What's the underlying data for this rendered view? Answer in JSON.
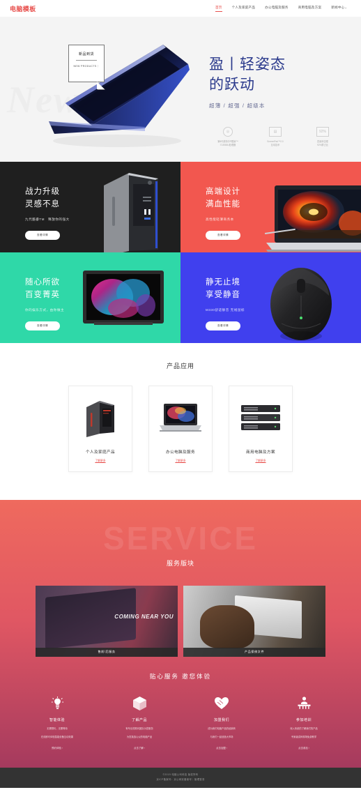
{
  "header": {
    "logo": "电脑模板",
    "nav": [
      {
        "label": "首页",
        "active": true
      },
      {
        "label": "个人及家庭产品",
        "active": false
      },
      {
        "label": "办公电脑及服务",
        "active": false
      },
      {
        "label": "商用电脑及方案",
        "active": false
      },
      {
        "label": "新闻中心",
        "active": false,
        "caret": "⌄"
      }
    ]
  },
  "hero": {
    "badge_title": "新品到货",
    "badge_sub": "NEW PRODUCTS｜",
    "heading_line1": "盈丨轻姿态",
    "heading_line2": "的跃动",
    "subtitle": "超薄 / 超强 / 超级本",
    "watermark": "New",
    "features": [
      {
        "icon": "cpu-icon",
        "glyph": "◎",
        "line1": "第8代英特尔®酷睿™",
        "line2": "i7-8565U处理器"
      },
      {
        "icon": "screen-icon",
        "glyph": "▤",
        "line1": "ScreenPad™2.0",
        "line2": "互动技术"
      },
      {
        "icon": "display-icon",
        "glyph": "92%",
        "line1": "四面窄边框",
        "line2": "92%屏占比"
      }
    ]
  },
  "panels": [
    {
      "theme": "dark",
      "heading_line1": "战力升级",
      "heading_line2": "灵感不息",
      "subtitle": "九代酷睿TM　释放你的强大",
      "button": "查看详情",
      "image": "desktop-tower-image"
    },
    {
      "theme": "red",
      "heading_line1": "高端设计",
      "heading_line2": "满血性能",
      "subtitle": "高性能轻薄商务本",
      "button": "查看详情",
      "image": "laptop-image"
    },
    {
      "theme": "teal",
      "heading_line1": "随心所欲",
      "heading_line2": "百变菁英",
      "subtitle": "你的娱乐方式，由你做主",
      "button": "查看详情",
      "image": "tablet-image"
    },
    {
      "theme": "blue",
      "heading_line1": "静无止境",
      "heading_line2": "享受静音",
      "subtitle": "M330舒适静音 无线鼠标",
      "button": "查看详情",
      "image": "wireless-mouse-image"
    }
  ],
  "applications": {
    "title": "产品应用",
    "cards": [
      {
        "name": "个人及家庭产品",
        "more": "了解更多",
        "image": "desktop-pc-image"
      },
      {
        "name": "办公电脑及服务",
        "more": "了解更多",
        "image": "office-laptop-image"
      },
      {
        "name": "商用电脑及方案",
        "more": "了解更多",
        "image": "server-rack-image"
      }
    ]
  },
  "service": {
    "watermark": "SERVICE",
    "title": "服务版块",
    "cards": [
      {
        "caption": "售前/后服务",
        "overlay": "COMING NEAR YOU",
        "image": "presentation-screens-image"
      },
      {
        "caption": "产品保修文件",
        "overlay": "",
        "image": "hand-on-laptop-image"
      }
    ]
  },
  "care": {
    "title": "贴心服务  邀您体验",
    "items": [
      {
        "icon": "lightbulb-icon",
        "glyph": "💡",
        "title": "智能体验",
        "desc_line1": "无需预约，无需等待",
        "desc_line2": "在线即可体验智能设备互动效果",
        "link": "预约体验 ›"
      },
      {
        "icon": "package-icon",
        "glyph": "📦",
        "title": "了解产品",
        "desc_line1": "有专业的顾问团队为您服务",
        "desc_line2": "为您挑选心仪的电脑产品",
        "link": "点击了解 ›"
      },
      {
        "icon": "handshake-icon",
        "glyph": "❤",
        "title": "加盟我们",
        "desc_line1": "成为我们电脑产品的经销商",
        "desc_line2": "与我们一起创造大市场",
        "link": "点击加盟 ›"
      },
      {
        "icon": "training-icon",
        "glyph": "🏫",
        "title": "参加培训",
        "desc_line1": "深入系统的了解我们的产品",
        "desc_line2": "专家级讲师现场免费教学",
        "link": "点击参加 ›"
      }
    ]
  },
  "footer": {
    "line1": "©2019 电脑公司科技 版权所有",
    "line2_a": "京ICP备案号：",
    "line2_b": "京公网安备案号",
    "line2_sep": "｜",
    "line2_c": "管理登录"
  }
}
